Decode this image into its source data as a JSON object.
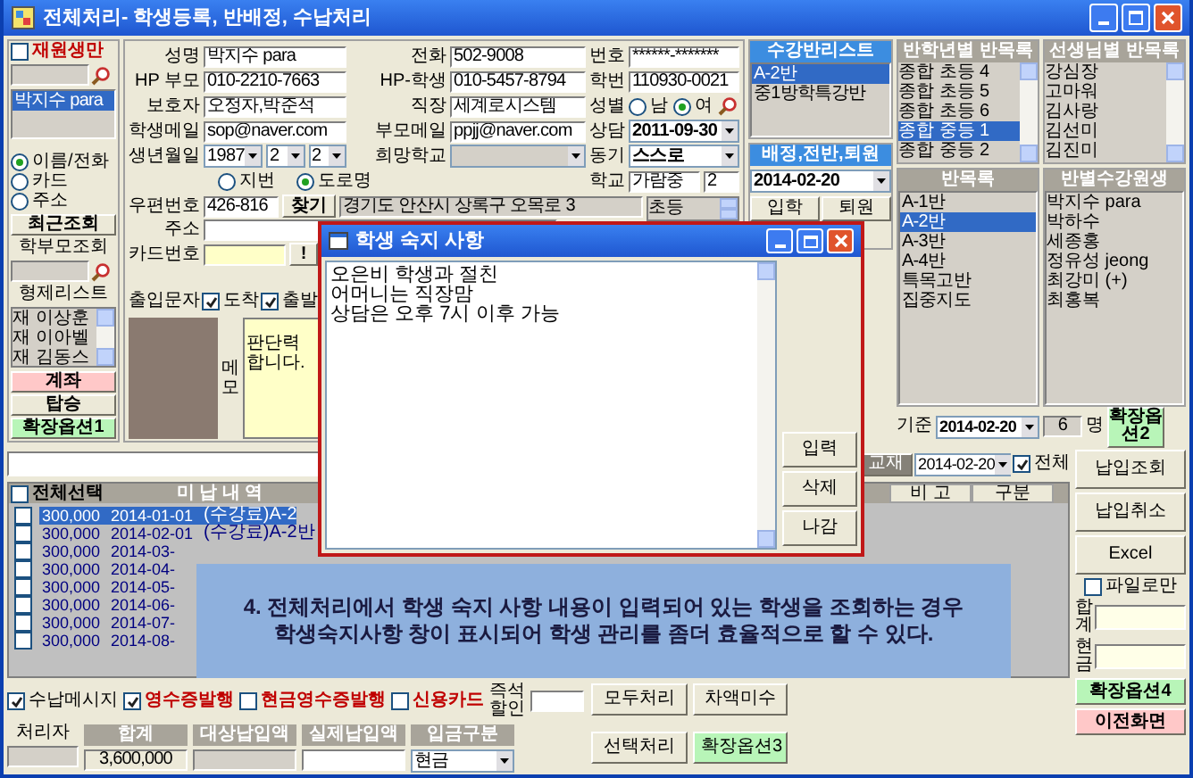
{
  "window": {
    "title": "전체처리- 학생등록, 반배정, 수납처리"
  },
  "left_panel": {
    "active_only": {
      "label": "재원생만",
      "checked": false
    },
    "students": [
      {
        "label": "박지수 para",
        "selected": true
      }
    ],
    "search_modes": [
      {
        "label": "이름/전화",
        "selected": true
      },
      {
        "label": "카드",
        "selected": false
      },
      {
        "label": "주소",
        "selected": false
      }
    ],
    "recent_button": "최근조회",
    "parent_search_label": "학부모조회",
    "siblings_title": "형제리스트",
    "siblings": [
      "재 이상훈",
      "재 이아벨",
      "재 김동스"
    ],
    "buttons": [
      {
        "label": "계좌",
        "kind": "pink"
      },
      {
        "label": "탑승",
        "kind": "plain"
      },
      {
        "label": "확장옵션1",
        "kind": "green"
      }
    ]
  },
  "student_form": {
    "columns": [
      [
        {
          "kind": "text",
          "label": "성명",
          "value": "박지수 para"
        },
        {
          "kind": "text",
          "label": "HP 부모",
          "value": "010-2210-7663"
        },
        {
          "kind": "text",
          "label": "보호자",
          "value": "오정자,박준석"
        },
        {
          "kind": "text",
          "label": "학생메일",
          "value": "sop@naver.com"
        },
        {
          "kind": "birth",
          "label": "생년월일",
          "values": [
            "1987",
            "2",
            "2"
          ]
        }
      ],
      [
        {
          "kind": "text",
          "label": "전화",
          "value": "502-9008"
        },
        {
          "kind": "text",
          "label": "HP-학생",
          "value": "010-5457-8794"
        },
        {
          "kind": "text",
          "label": "직장",
          "value": "세계로시스템"
        },
        {
          "kind": "text",
          "label": "부모메일",
          "value": "ppjj@naver.com"
        },
        {
          "kind": "select",
          "label": "희망학교"
        }
      ],
      [
        {
          "kind": "text",
          "label": "번호",
          "value": "******-*******"
        },
        {
          "kind": "text",
          "label": "학번",
          "value": "110930-0021"
        },
        {
          "kind": "gender",
          "label": "성별",
          "options": [
            {
              "label": "남",
              "selected": false
            },
            {
              "label": "여",
              "selected": true
            }
          ]
        },
        {
          "kind": "select",
          "label": "상담",
          "value": "2011-09-30"
        },
        {
          "kind": "select",
          "label": "동기",
          "value": "스스로"
        }
      ]
    ],
    "address_type": [
      {
        "label": "지번",
        "selected": false
      },
      {
        "label": "도로명",
        "selected": true
      }
    ],
    "school": {
      "label": "학교",
      "value": "가람중",
      "grade": "2"
    },
    "postcode": {
      "label": "우편번호",
      "value": "426-816",
      "button": "찾기",
      "road_address": "경기도 안산시 상록구 오목로 3"
    },
    "levels": [
      "초등"
    ],
    "address": {
      "label": "주소"
    },
    "card": {
      "label": "카드번호",
      "button": "!"
    },
    "access_sms": {
      "label": "출입문자",
      "options": [
        {
          "label": "도착",
          "checked": true
        },
        {
          "label": "출발",
          "checked": true
        }
      ]
    },
    "memo": {
      "label": "메모",
      "lines": [
        "판단력",
        "합니다."
      ]
    }
  },
  "class_list": {
    "title": "수강반리스트",
    "items": [
      {
        "label": "A-2반",
        "selected": true
      },
      {
        "label": "중1방학특강반",
        "selected": false
      }
    ]
  },
  "assignment": {
    "title": "배정,전반,퇴원",
    "date": "2014-02-20",
    "buttons": [
      "입학",
      "퇴원"
    ]
  },
  "grade_classes": {
    "title": "반학년별 반목록",
    "items": [
      {
        "label": "종합 초등 4",
        "selected": false
      },
      {
        "label": "종합 초등 5",
        "selected": false
      },
      {
        "label": "종합 초등 6",
        "selected": false
      },
      {
        "label": "종합 중등 1",
        "selected": true
      },
      {
        "label": "종합 중등 2",
        "selected": false
      }
    ]
  },
  "teacher_classes": {
    "title": "선생님별 반목록",
    "items": [
      "강심장",
      "고마워",
      "김사랑",
      "김선미",
      "김진미"
    ]
  },
  "classes": {
    "title": "반목록",
    "items": [
      {
        "label": "A-1반",
        "selected": false
      },
      {
        "label": "A-2반",
        "selected": true
      },
      {
        "label": "A-3반",
        "selected": false
      },
      {
        "label": "A-4반",
        "selected": false
      },
      {
        "label": "특목고반",
        "selected": false
      },
      {
        "label": "집중지도",
        "selected": false
      }
    ]
  },
  "class_students": {
    "title": "반별수강원생",
    "items": [
      "박지수 para",
      "박하수",
      "세종홍",
      "정유성 jeong",
      "최강미 (+)",
      "최홍복"
    ]
  },
  "basis": {
    "label": "기준",
    "date": "2014-02-20",
    "count": "6",
    "unit": "명",
    "button": "확장옵션2"
  },
  "payments": {
    "textbook_button": {
      "label": "교재",
      "disabled": true
    },
    "date": "2014-02-20",
    "all": {
      "label": "전체",
      "checked": true
    },
    "select_all": {
      "label": "전체선택",
      "checked": false
    },
    "columns": [
      "미 납 내 역",
      "비 고",
      "구분"
    ],
    "rows": [
      {
        "checked": false,
        "selected": true,
        "amount": "300,000",
        "date": "2014-01-01",
        "item": "(수강료)A-2"
      },
      {
        "checked": false,
        "selected": false,
        "amount": "300,000",
        "date": "2014-02-01",
        "item": "(수강료)A-2반"
      },
      {
        "checked": false,
        "selected": false,
        "amount": "300,000",
        "date": "2014-03-"
      },
      {
        "checked": false,
        "selected": false,
        "amount": "300,000",
        "date": "2014-04-"
      },
      {
        "checked": false,
        "selected": false,
        "amount": "300,000",
        "date": "2014-05-"
      },
      {
        "checked": false,
        "selected": false,
        "amount": "300,000",
        "date": "2014-06-"
      },
      {
        "checked": false,
        "selected": false,
        "amount": "300,000",
        "date": "2014-07-"
      },
      {
        "checked": false,
        "selected": false,
        "amount": "300,000",
        "date": "2014-08-"
      }
    ]
  },
  "options": [
    {
      "label": "수납메시지",
      "checked": true,
      "kind": "plain"
    },
    {
      "label": "영수증발행",
      "checked": true,
      "kind": "alert"
    },
    {
      "label": "현금영수증발행",
      "checked": false,
      "kind": "alert"
    },
    {
      "label": "신용카드",
      "checked": false,
      "kind": "alert"
    }
  ],
  "instant_discount": {
    "label": "즉석할인"
  },
  "totals": {
    "handler_label": "처리자",
    "columns": [
      {
        "kind": "text",
        "label": "합계",
        "value": "3,600,000"
      },
      {
        "kind": "text",
        "label": "대상납입액"
      },
      {
        "kind": "text",
        "label": "실제납입액"
      },
      {
        "kind": "select",
        "label": "입금구분",
        "value": "현금"
      }
    ]
  },
  "actions": [
    {
      "label": "모두처리",
      "kind": "plain"
    },
    {
      "label": "차액미수",
      "kind": "plain"
    },
    {
      "label": "선택처리",
      "kind": "plain"
    },
    {
      "label": "확장옵션3",
      "kind": "green"
    }
  ],
  "side": {
    "buttons": [
      "납입조회",
      "납입취소",
      "Excel"
    ],
    "file_only": {
      "label": "파일로만",
      "checked": false
    },
    "fields": [
      {
        "label": "합계"
      },
      {
        "label": "현금"
      }
    ],
    "actions": [
      {
        "label": "확장옵션4",
        "kind": "green"
      },
      {
        "label": "이전화면",
        "kind": "pink"
      }
    ]
  },
  "dialog": {
    "title": "학생 숙지 사항",
    "lines": [
      "오은비 학생과 절친",
      "어머니는 직장맘",
      "상담은 오후 7시 이후 가능"
    ],
    "buttons": [
      "입력",
      "삭제",
      "나감"
    ]
  },
  "callout": {
    "lines": [
      "4. 전체처리에서 학생 숙지 사항 내용이 입력되어 있는 학생을 조회하는 경우",
      "학생숙지사항 창이 표시되어 학생 관리를 좀더 효율적으로 할 수 있다."
    ]
  }
}
